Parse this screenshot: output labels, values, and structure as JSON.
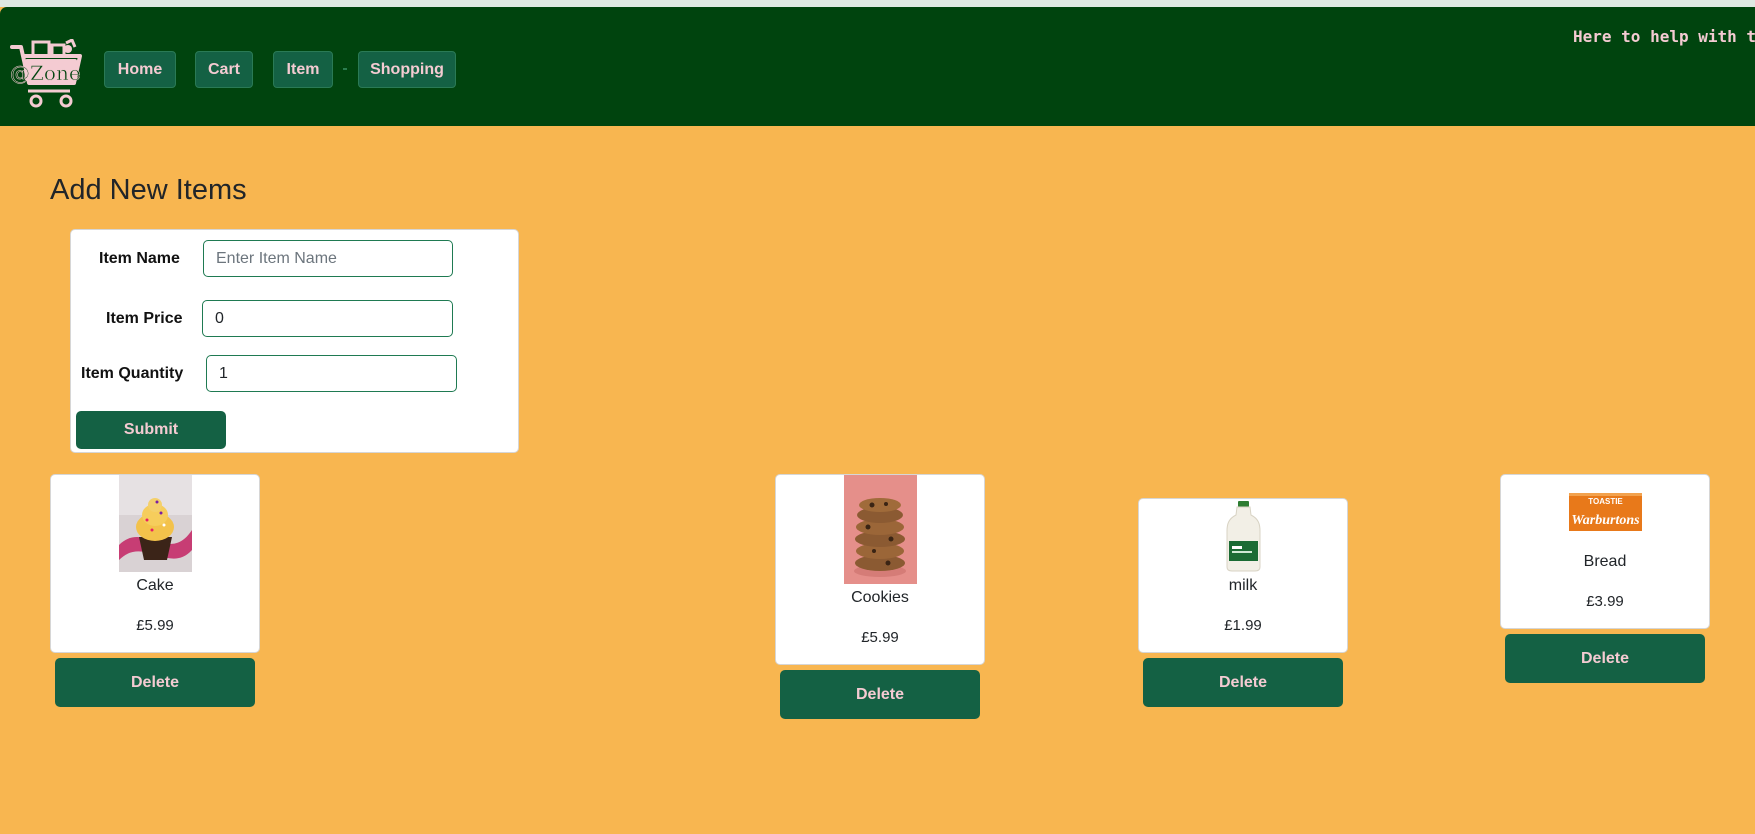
{
  "header": {
    "logo_text": "@Zone",
    "nav": [
      {
        "label": "Home"
      },
      {
        "label": "Cart"
      },
      {
        "label": "Item"
      },
      {
        "label": "Shopping"
      }
    ],
    "tagline": "Here to help with the c"
  },
  "form": {
    "title": "Add New Items",
    "name_label": "Item Name",
    "name_placeholder": "Enter Item Name",
    "name_value": "",
    "price_label": "Item Price",
    "price_value": "0",
    "quantity_label": "Item Quantity",
    "quantity_value": "1",
    "submit_label": "Submit"
  },
  "items": [
    {
      "name": "Cake",
      "price": "£5.99",
      "image_icon": "cupcake-image",
      "delete_label": "Delete"
    },
    {
      "name": "Cookies",
      "price": "£5.99",
      "image_icon": "cookies-image",
      "delete_label": "Delete"
    },
    {
      "name": "milk",
      "price": "£1.99",
      "image_icon": "milk-bottle-image",
      "delete_label": "Delete"
    },
    {
      "name": "Bread",
      "price": "£3.99",
      "image_icon": "bread-package-image",
      "delete_label": "Delete",
      "image_text_top": "TOASTIE",
      "image_text_brand": "Warburtons"
    }
  ],
  "colors": {
    "page_background": "#f8b650",
    "navbar": "#00440e",
    "button": "#146144",
    "button_text": "#f4cbd2"
  }
}
